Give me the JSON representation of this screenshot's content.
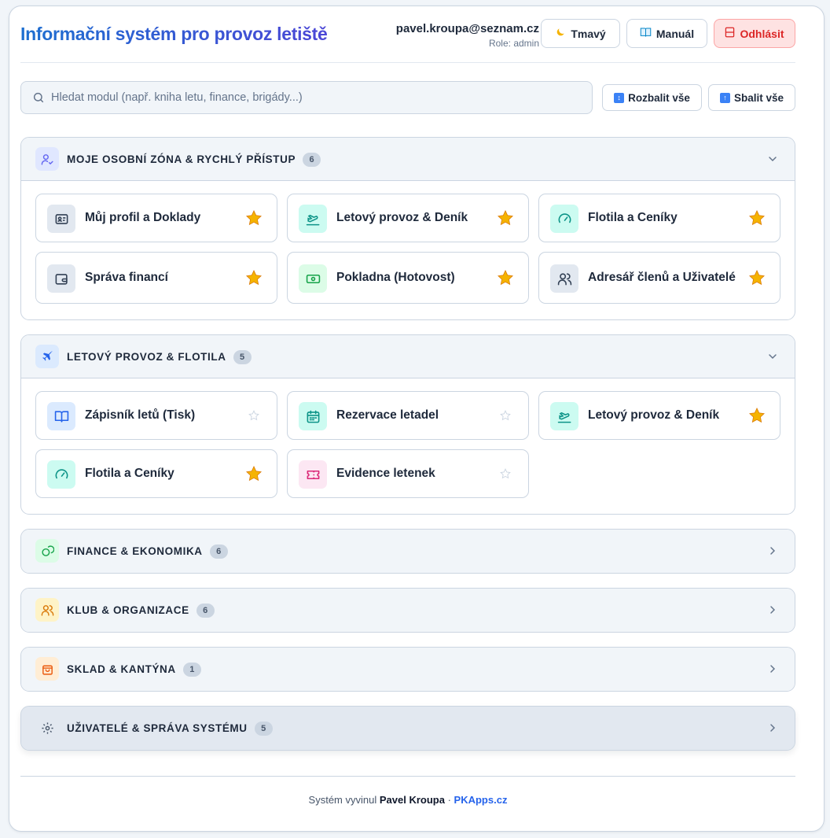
{
  "header": {
    "title": "Informační systém pro provoz letiště",
    "user_email": "pavel.kroupa@seznam.cz",
    "user_role": "Role: admin",
    "theme_button": "Tmavý",
    "manual_button": "Manuál",
    "logout_button": "Odhlásit"
  },
  "toolbar": {
    "search_placeholder": "Hledat modul (např. kniha letu, finance, brigády...)",
    "search_value": "",
    "expand_all": "Rozbalit vše",
    "collapse_all": "Sbalit vše"
  },
  "sections": [
    {
      "title": "MOJE OSOBNÍ ZÓNA & RYCHLÝ PŘÍSTUP",
      "count": "6",
      "state": "expanded",
      "icon": "user-check-icon",
      "tiles": [
        {
          "label": "Můj profil a Doklady",
          "icon": "id-card-icon",
          "favorite": true
        },
        {
          "label": "Letový provoz & Deník",
          "icon": "plane-takeoff-icon",
          "favorite": true
        },
        {
          "label": "Flotila a Ceníky",
          "icon": "gauge-icon",
          "favorite": true
        },
        {
          "label": "Správa financí",
          "icon": "wallet-icon",
          "favorite": true
        },
        {
          "label": "Pokladna (Hotovost)",
          "icon": "banknote-icon",
          "favorite": true
        },
        {
          "label": "Adresář členů a Uživatelé",
          "icon": "users-icon",
          "favorite": true
        }
      ]
    },
    {
      "title": "LETOVÝ PROVOZ & FLOTILA",
      "count": "5",
      "state": "expanded",
      "icon": "plane-icon",
      "tiles": [
        {
          "label": "Zápisník letů (Tisk)",
          "icon": "book-open-icon",
          "favorite": false
        },
        {
          "label": "Rezervace letadel",
          "icon": "calendar-icon",
          "favorite": false
        },
        {
          "label": "Letový provoz & Deník",
          "icon": "plane-takeoff-icon",
          "favorite": true
        },
        {
          "label": "Flotila a Ceníky",
          "icon": "gauge-icon",
          "favorite": true
        },
        {
          "label": "Evidence letenek",
          "icon": "ticket-icon",
          "favorite": false
        }
      ]
    },
    {
      "title": "FINANCE & EKONOMIKA",
      "count": "6",
      "state": "collapsed",
      "icon": "coins-icon"
    },
    {
      "title": "KLUB & ORGANIZACE",
      "count": "6",
      "state": "collapsed",
      "icon": "users-icon"
    },
    {
      "title": "SKLAD & KANTÝNA",
      "count": "1",
      "state": "collapsed",
      "icon": "shopping-bag-icon"
    },
    {
      "title": "UŽIVATELÉ & SPRÁVA SYSTÉMU",
      "count": "5",
      "state": "collapsed",
      "icon": "settings-icon"
    }
  ],
  "footer": {
    "prefix": "Systém vyvinul",
    "author": "Pavel Kroupa",
    "separator": "·",
    "site": "PKApps.cz"
  },
  "colors": {
    "title_gradient_start": "#1d6fd0",
    "title_gradient_end": "#4b46d6",
    "logout_bg": "#fee2e2",
    "logout_text": "#dc2626",
    "favorite_star": "#f5b301",
    "link": "#2563eb"
  }
}
